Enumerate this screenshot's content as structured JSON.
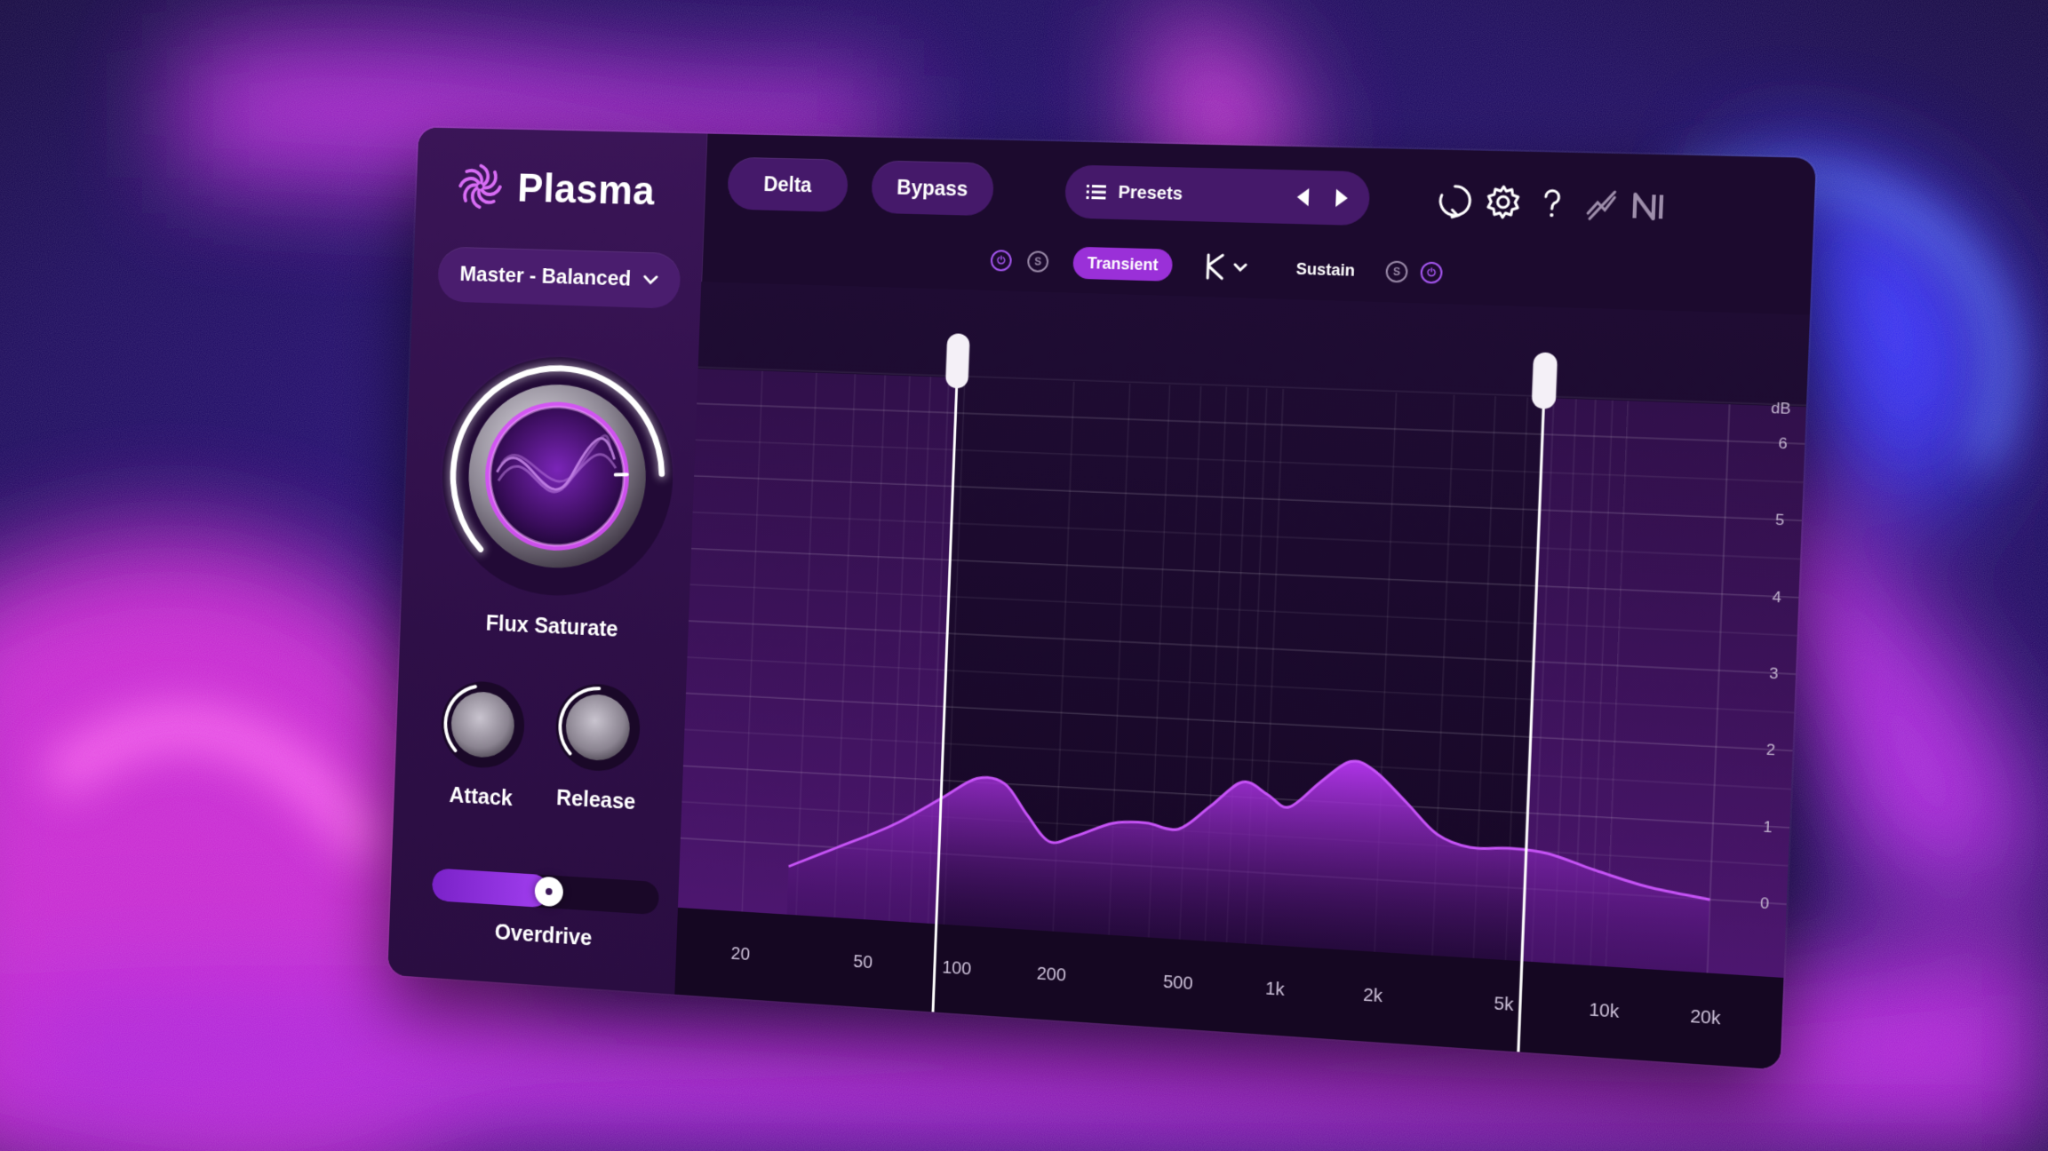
{
  "app": {
    "title": "Plasma",
    "mode_select": "Master - Balanced"
  },
  "toolbar": {
    "delta_label": "Delta",
    "bypass_label": "Bypass",
    "presets_label": "Presets"
  },
  "knobs": {
    "main_label": "Flux Saturate",
    "main_value": 0.82,
    "attack_label": "Attack",
    "attack_value": 0.45,
    "release_label": "Release",
    "release_value": 0.5
  },
  "overdrive": {
    "label": "Overdrive",
    "value": 0.52
  },
  "bands": {
    "transient_label": "Transient",
    "sustain_label": "Sustain",
    "solo_label": "S",
    "crossover_low_hz": 85,
    "crossover_high_hz": 5600
  },
  "spectrum": {
    "freq_ticks": [
      "20",
      "50",
      "100",
      "200",
      "500",
      "1k",
      "2k",
      "5k",
      "10k",
      "20k"
    ],
    "freq_values": [
      20,
      50,
      100,
      200,
      500,
      1000,
      2000,
      5000,
      10000,
      20000
    ],
    "db_unit": "dB",
    "db_ticks": [
      "6",
      "5",
      "4",
      "3",
      "2",
      "1",
      "0"
    ],
    "db_values": [
      6,
      5,
      4,
      3,
      2,
      1,
      0
    ],
    "curve": [
      [
        28,
        -0.3
      ],
      [
        40,
        0.0
      ],
      [
        60,
        0.35
      ],
      [
        85,
        0.75
      ],
      [
        110,
        1.05
      ],
      [
        135,
        1.0
      ],
      [
        160,
        0.6
      ],
      [
        190,
        0.25
      ],
      [
        230,
        0.35
      ],
      [
        300,
        0.55
      ],
      [
        380,
        0.58
      ],
      [
        480,
        0.52
      ],
      [
        600,
        0.85
      ],
      [
        750,
        1.2
      ],
      [
        900,
        1.05
      ],
      [
        1050,
        0.9
      ],
      [
        1300,
        1.25
      ],
      [
        1600,
        1.55
      ],
      [
        1900,
        1.45
      ],
      [
        2400,
        1.05
      ],
      [
        3000,
        0.65
      ],
      [
        3800,
        0.5
      ],
      [
        5000,
        0.52
      ],
      [
        6500,
        0.48
      ],
      [
        9000,
        0.3
      ],
      [
        13000,
        0.12
      ],
      [
        20000,
        0.0
      ]
    ]
  },
  "colors": {
    "accent": "#a23ff0",
    "panel": "#1c0a2e",
    "sidebar": "#341350"
  }
}
